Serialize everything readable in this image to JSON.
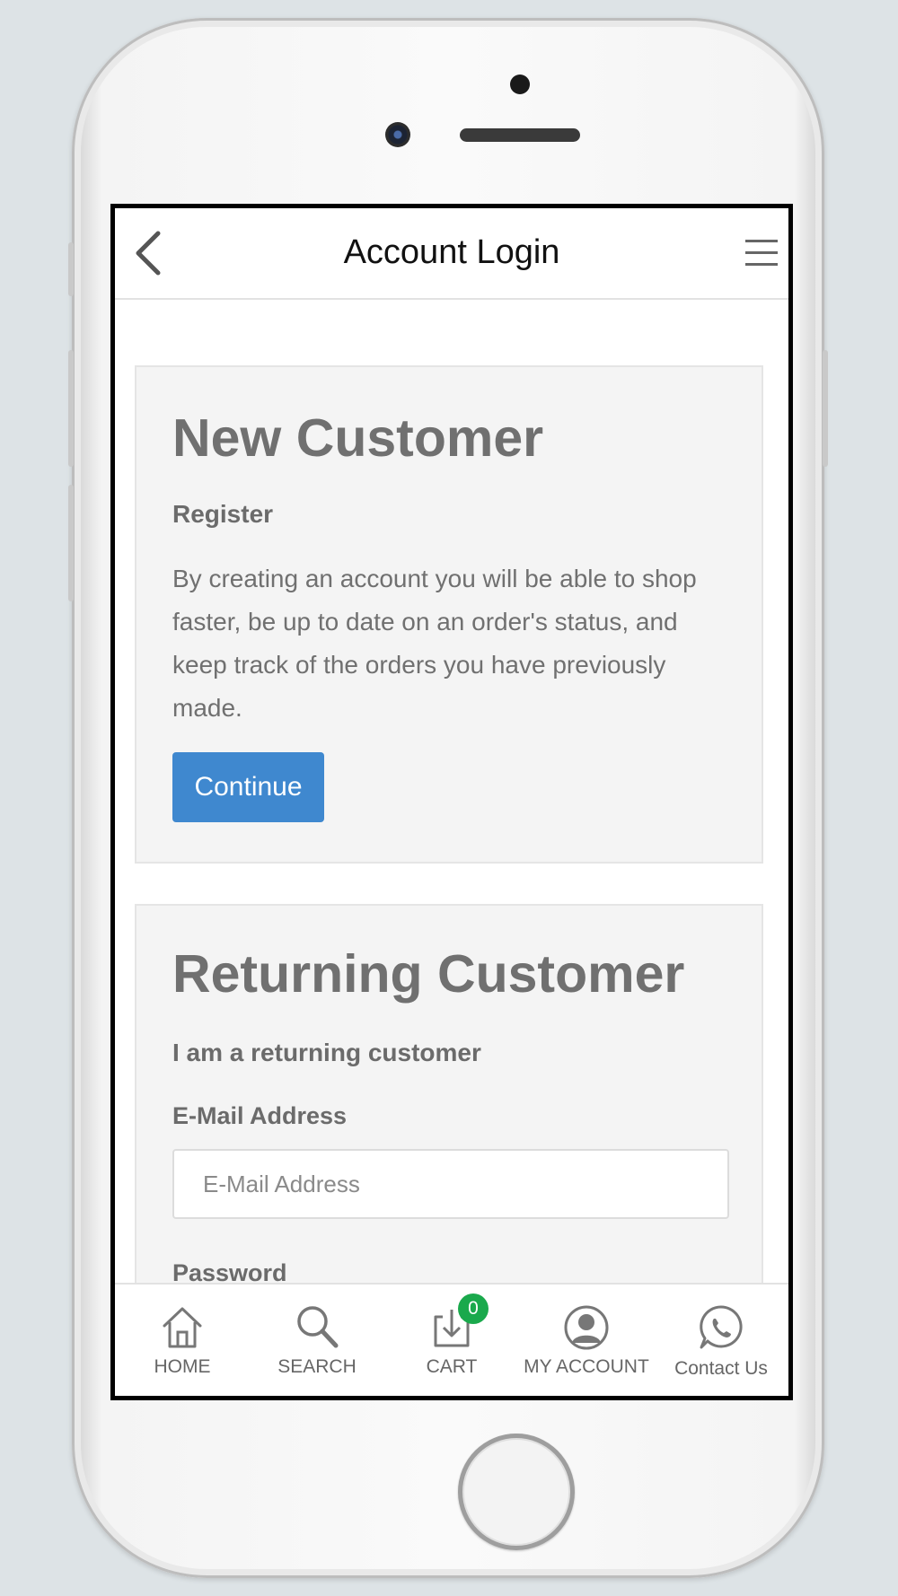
{
  "header": {
    "title": "Account Login"
  },
  "new_customer": {
    "heading": "New Customer",
    "subheading": "Register",
    "description": "By creating an account you will be able to shop faster, be up to date on an order's status, and keep track of the orders you have previously made.",
    "button_label": "Continue"
  },
  "returning_customer": {
    "heading": "Returning Customer",
    "subheading": "I am a returning customer",
    "email_label": "E-Mail Address",
    "email_placeholder": "E-Mail Address",
    "email_value": "",
    "password_label": "Password"
  },
  "tabbar": {
    "items": [
      {
        "label": "HOME",
        "icon": "home-icon"
      },
      {
        "label": "SEARCH",
        "icon": "search-icon"
      },
      {
        "label": "CART",
        "icon": "cart-icon",
        "badge": "0"
      },
      {
        "label": "MY ACCOUNT",
        "icon": "account-icon"
      },
      {
        "label": "Contact Us",
        "icon": "whatsapp-icon"
      }
    ]
  },
  "colors": {
    "accent": "#3f88cf",
    "badge": "#1aa94c",
    "card_bg": "#f4f4f4",
    "heading_text": "#707070"
  }
}
